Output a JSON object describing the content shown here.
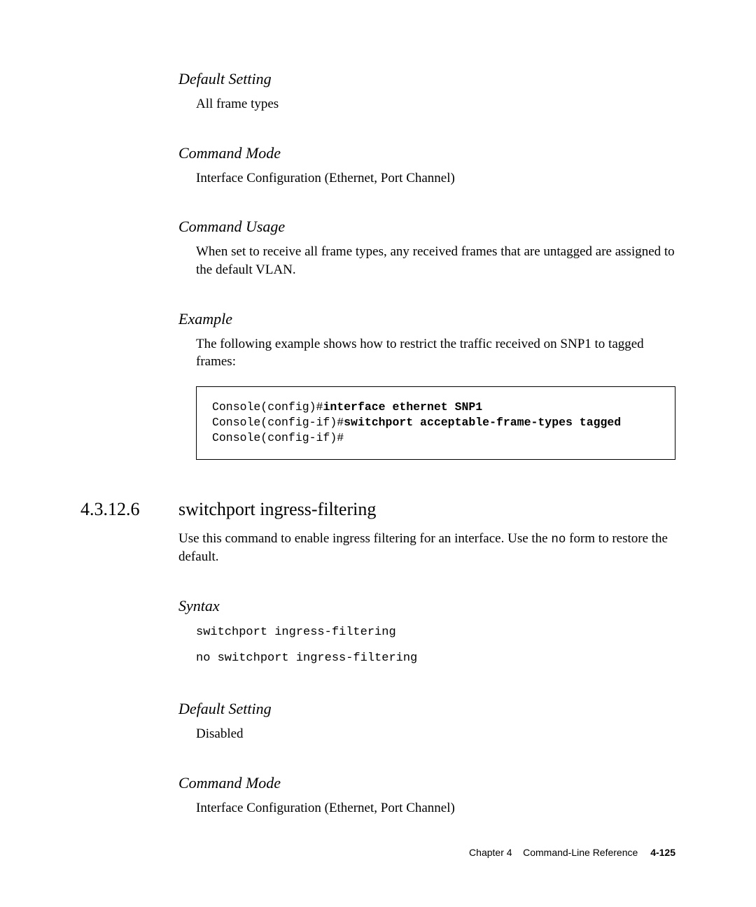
{
  "sections": {
    "default_setting_1": {
      "heading": "Default Setting",
      "text": "All frame types"
    },
    "command_mode_1": {
      "heading": "Command Mode",
      "text": "Interface Configuration (Ethernet, Port Channel)"
    },
    "command_usage": {
      "heading": "Command Usage",
      "text": "When set to receive all frame types, any received frames that are untagged are assigned to the default VLAN."
    },
    "example": {
      "heading": "Example",
      "intro": "The following example shows how to restrict the traffic received on SNP1 to tagged frames:",
      "code": {
        "line1_prefix": "Console(config)#",
        "line1_bold": "interface ethernet SNP1",
        "line2_prefix": "Console(config-if)#",
        "line2_bold": "switchport acceptable-frame-types tagged",
        "line3": "Console(config-if)#"
      }
    },
    "main_section": {
      "number": "4.3.12.6",
      "title": "switchport ingress-filtering",
      "desc_part1": "Use this command to enable ingress filtering for an interface. Use the ",
      "desc_mono": "no",
      "desc_part2": " form to restore the default."
    },
    "syntax": {
      "heading": "Syntax",
      "line1": "switchport ingress-filtering",
      "line2": "no switchport ingress-filtering"
    },
    "default_setting_2": {
      "heading": "Default Setting",
      "text": "Disabled"
    },
    "command_mode_2": {
      "heading": "Command Mode",
      "text": "Interface Configuration (Ethernet, Port Channel)"
    }
  },
  "footer": {
    "chapter": "Chapter 4",
    "title": "Command-Line Reference",
    "page": "4-125"
  }
}
